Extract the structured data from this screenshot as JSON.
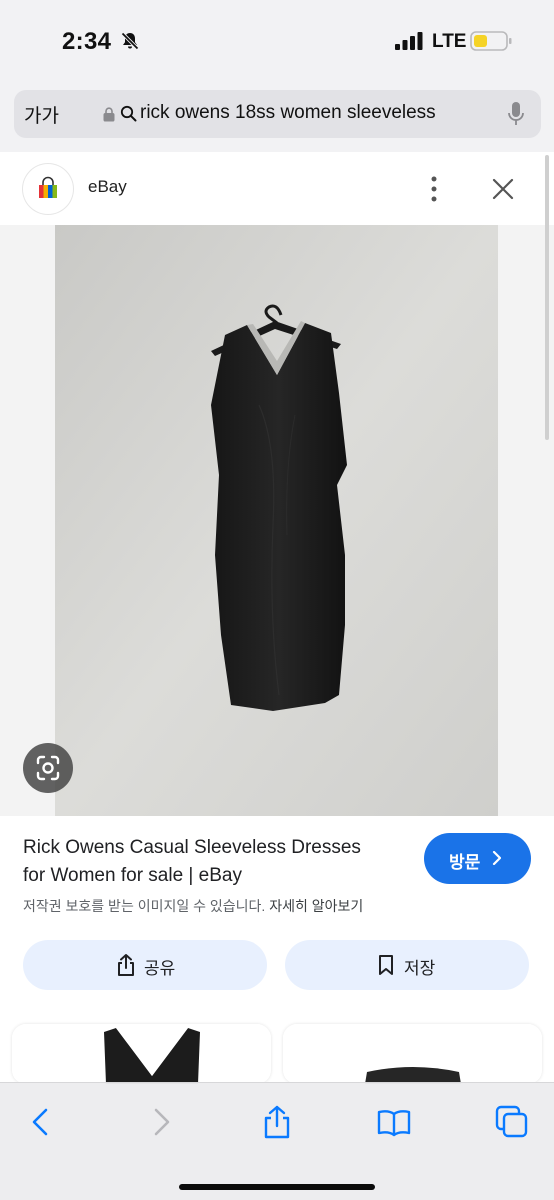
{
  "status": {
    "time": "2:34",
    "network": "LTE",
    "battery_color": "#f5d327"
  },
  "address_bar": {
    "text_size": "가가",
    "url": "rick owens 18ss women sleeveless"
  },
  "site": {
    "name": "eBay"
  },
  "result": {
    "title_line1": "Rick Owens Casual Sleeveless Dresses",
    "title_line2": "for Women for sale | eBay",
    "visit_label": "방문",
    "copyright_text": "저작권 보호를 받는 이미지일 수 있습니다.",
    "learn_more": "자세히 알아보기",
    "share_label": "공유",
    "save_label": "저장"
  },
  "icons": {
    "bell": "bell-slash-icon",
    "lens": "google-lens-icon",
    "back": "chevron-left-icon",
    "forward": "chevron-right-icon",
    "share": "share-icon",
    "bookmarks": "book-icon",
    "tabs": "tabs-icon"
  },
  "colors": {
    "accent": "#1a73e8",
    "chip": "#e8f0fe",
    "ios_blue": "#0a7aff"
  }
}
